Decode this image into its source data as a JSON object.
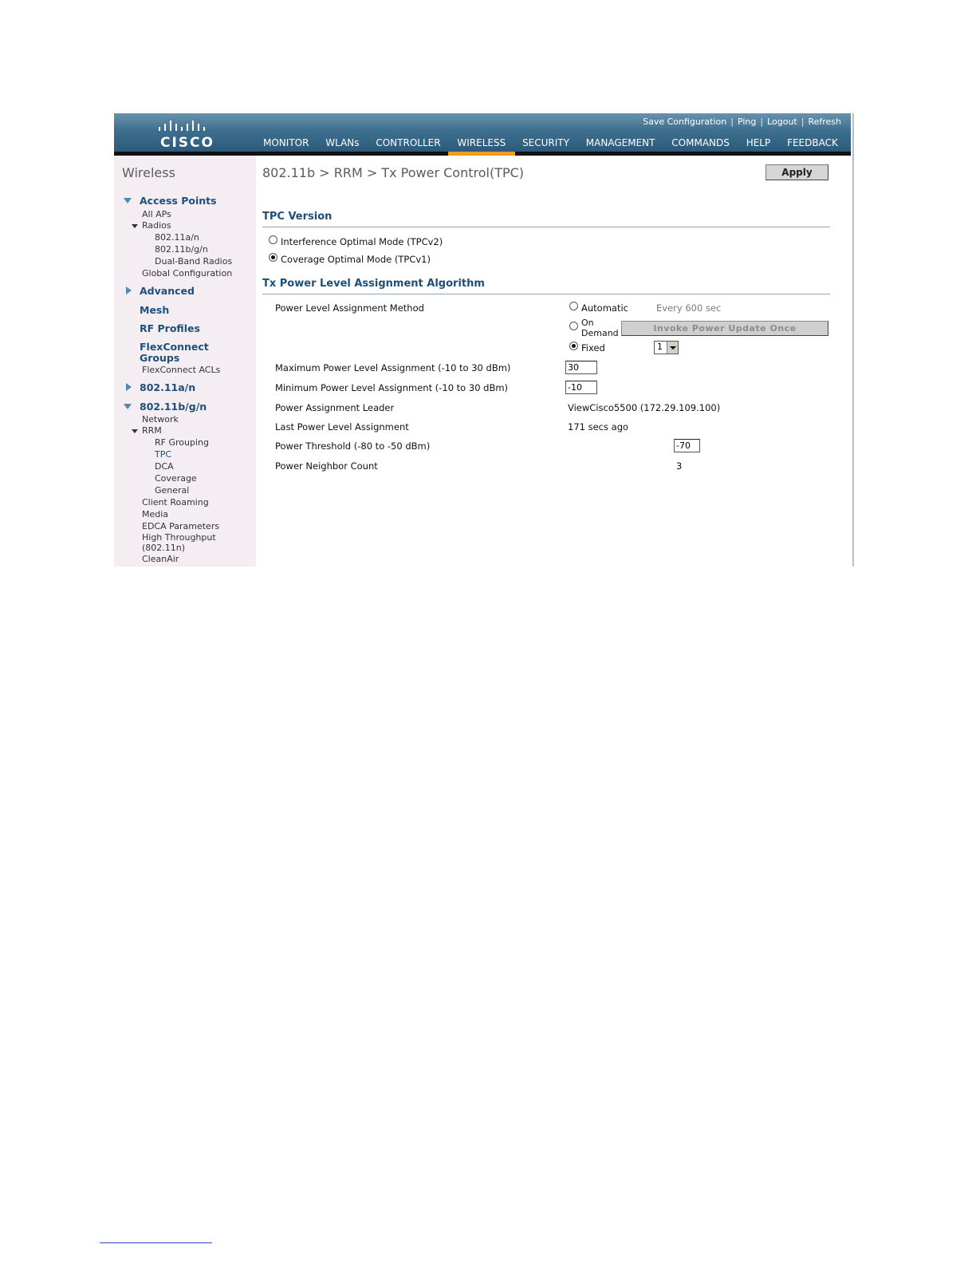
{
  "header": {
    "logo_text": "CISCO",
    "top_links": [
      "Save Configuration",
      "Ping",
      "Logout",
      "Refresh"
    ],
    "nav_items": [
      "MONITOR",
      "WLANs",
      "CONTROLLER",
      "WIRELESS",
      "SECURITY",
      "MANAGEMENT",
      "COMMANDS",
      "HELP",
      "FEEDBACK"
    ],
    "active_nav": "WIRELESS",
    "accent_color": "#f29b1d"
  },
  "sidebar": {
    "title": "Wireless",
    "access_points": "Access Points",
    "all_aps": "All APs",
    "radios": "Radios",
    "radio_80211an": "802.11a/n",
    "radio_80211bgn": "802.11b/g/n",
    "dual_band": "Dual-Band Radios",
    "global_config": "Global Configuration",
    "advanced": "Advanced",
    "mesh": "Mesh",
    "rf_profiles": "RF Profiles",
    "flexconnect_groups_1": "FlexConnect",
    "flexconnect_groups_2": "Groups",
    "flexconnect_acls": "FlexConnect ACLs",
    "dot11an": "802.11a/n",
    "dot11bgn": "802.11b/g/n",
    "network": "Network",
    "rrm": "RRM",
    "rf_grouping": "RF Grouping",
    "tpc": "TPC",
    "dca": "DCA",
    "coverage": "Coverage",
    "general": "General",
    "client_roaming": "Client Roaming",
    "media": "Media",
    "edca": "EDCA Parameters",
    "high_throughput_1": "High Throughput",
    "high_throughput_2": "(802.11n)",
    "cleanair": "CleanAir"
  },
  "main": {
    "page_title": "802.11b > RRM > Tx Power Control(TPC)",
    "apply_label": "Apply",
    "tpc_version": {
      "heading": "TPC Version",
      "option_v2": "Interference Optimal Mode (TPCv2)",
      "option_v1": "Coverage Optimal Mode (TPCv1)",
      "selected": "Coverage Optimal Mode (TPCv1)"
    },
    "algorithm": {
      "heading": "Tx Power Level Assignment Algorithm",
      "method_label": "Power Level Assignment Method",
      "automatic_label": "Automatic",
      "automatic_note": "Every 600 sec",
      "on_demand_label_1": "On",
      "on_demand_label_2": "Demand",
      "invoke_label": "Invoke Power Update Once",
      "fixed_label": "Fixed",
      "fixed_value": "1",
      "selected_method": "Fixed",
      "max_label": "Maximum Power Level Assignment (-10 to 30 dBm)",
      "max_value": "30",
      "min_label": "Minimum Power Level Assignment (-10 to 30 dBm)",
      "min_value": "-10",
      "leader_label": "Power Assignment Leader",
      "leader_value": "ViewCisco5500 (172.29.109.100)",
      "last_label": "Last Power Level Assignment",
      "last_value": "171 secs ago",
      "threshold_label": "Power Threshold (-80 to -50 dBm)",
      "threshold_value": "-70",
      "neighbor_label": "Power Neighbor Count",
      "neighbor_value": "3"
    }
  }
}
